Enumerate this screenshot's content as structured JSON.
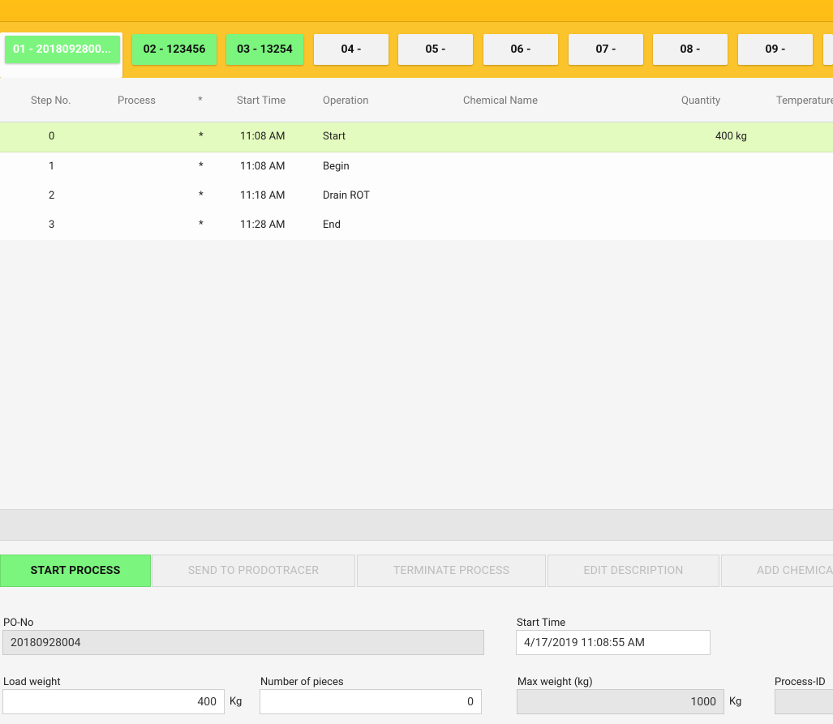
{
  "tabs": [
    {
      "label": "01 - 2018092800..."
    },
    {
      "label": "02 - 123456"
    },
    {
      "label": "03 - 13254"
    },
    {
      "label": "04 -"
    },
    {
      "label": "05 -"
    },
    {
      "label": "06 -"
    },
    {
      "label": "07 -"
    },
    {
      "label": "08 -"
    },
    {
      "label": "09 -"
    }
  ],
  "grid": {
    "headers": {
      "step_no": "Step No.",
      "process": "Process",
      "star": "*",
      "start_time": "Start Time",
      "operation": "Operation",
      "chemical_name": "Chemical Name",
      "quantity": "Quantity",
      "temperature": "Temperature"
    },
    "rows": [
      {
        "step": "0",
        "process": "",
        "star": "*",
        "time": "11:08 AM",
        "operation": "Start",
        "chemical": "",
        "quantity": "400 kg"
      },
      {
        "step": "1",
        "process": "",
        "star": "*",
        "time": "11:08 AM",
        "operation": "Begin",
        "chemical": "",
        "quantity": ""
      },
      {
        "step": "2",
        "process": "",
        "star": "*",
        "time": "11:18 AM",
        "operation": "Drain ROT",
        "chemical": "",
        "quantity": ""
      },
      {
        "step": "3",
        "process": "",
        "star": "*",
        "time": "11:28 AM",
        "operation": "End",
        "chemical": "",
        "quantity": ""
      }
    ]
  },
  "actions": {
    "start_process": "START PROCESS",
    "send_to_prodotracer": "SEND TO PRODOTRACER",
    "terminate_process": "TERMINATE PROCESS",
    "edit_description": "EDIT DESCRIPTION",
    "add_chemical": "ADD CHEMICAL"
  },
  "form": {
    "po_no": {
      "label": "PO-No",
      "value": "20180928004"
    },
    "start_time": {
      "label": "Start Time",
      "value": "4/17/2019 11:08:55 AM"
    },
    "load_weight": {
      "label": "Load weight",
      "value": "400",
      "unit": "Kg"
    },
    "number_of_pieces": {
      "label": "Number of pieces",
      "value": "0"
    },
    "max_weight": {
      "label": "Max weight (kg)",
      "value": "1000",
      "unit": "Kg"
    },
    "process_id": {
      "label": "Process-ID",
      "value": ""
    }
  },
  "colors": {
    "header_yellow": "#fcc42c",
    "active_green": "#7cf57e",
    "selected_row": "#e4fbbf"
  }
}
